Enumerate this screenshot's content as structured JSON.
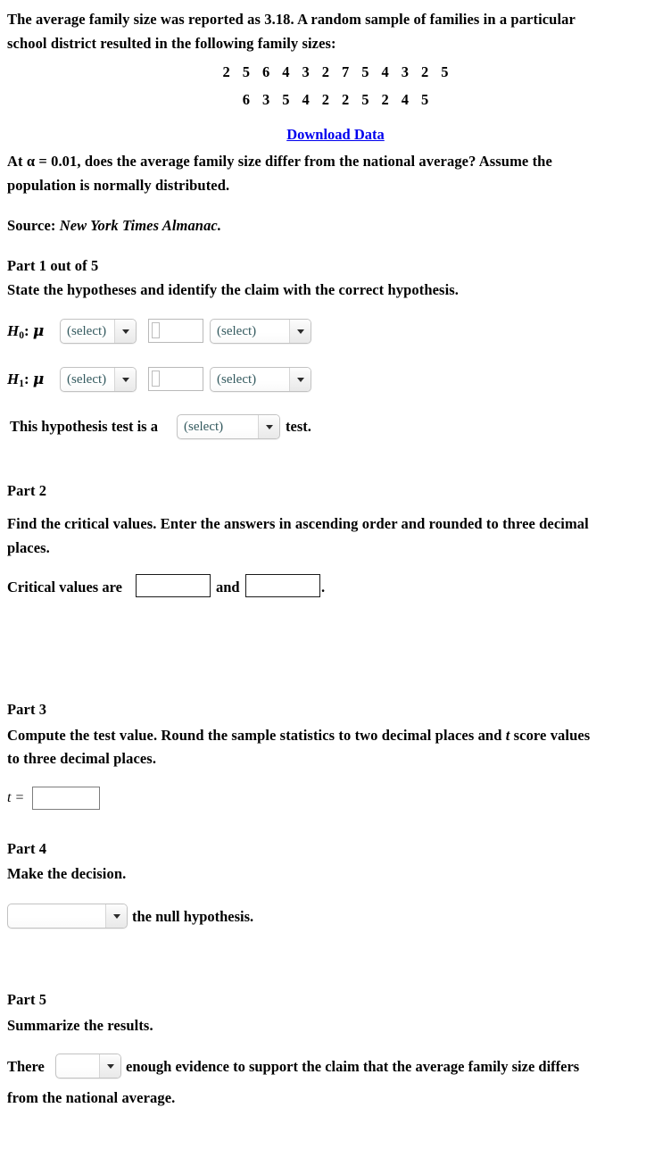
{
  "problem": {
    "intro_line1": "The average family size was reported as 3.18. A random sample of families in a particular",
    "intro_line2": "school district resulted in the following family sizes:",
    "data_row1": [
      2,
      5,
      6,
      4,
      3,
      2,
      7,
      5,
      4,
      3,
      2,
      5
    ],
    "data_row2": [
      6,
      3,
      5,
      4,
      2,
      2,
      5,
      2,
      4,
      5
    ],
    "download_link": "Download Data",
    "question_line1": "At α = 0.01, does the average family size differ from the national average? Assume the",
    "question_line2": "population is normally distributed.",
    "source_label": "Source:",
    "source_value": "New York Times Almanac."
  },
  "part1": {
    "heading": "Part 1 out of 5",
    "instruction": "State the hypotheses and identify the claim with the correct hypothesis.",
    "h0_label_H": "H",
    "h0_label_sub": "0",
    "h0_label_colon": ":",
    "h0_label_mu": "μ",
    "h1_label_H": "H",
    "h1_label_sub": "1",
    "h1_label_colon": ":",
    "h1_label_mu": "μ",
    "h0_operator_select": "(select)",
    "h0_value_input": "",
    "h0_claim_select": "(select)",
    "h1_operator_select": "(select)",
    "h1_value_input": "",
    "h1_claim_select": "(select)",
    "test_type_prefix": "This hypothesis test is a",
    "test_type_select": "(select)",
    "test_type_suffix": "test."
  },
  "part2": {
    "heading": "Part 2",
    "instruction_line1": "Find the critical values. Enter the answers in ascending order and rounded to three decimal",
    "instruction_line2": "places.",
    "prefix": "Critical values are",
    "value1": "",
    "conjunction": "and",
    "value2": "",
    "suffix": "."
  },
  "part3": {
    "heading": "Part 3",
    "instruction_line1_a": "Compute the test value. Round the sample statistics to two decimal places and",
    "instruction_line1_t": "t",
    "instruction_line1_b": "score values",
    "instruction_line2": "to three decimal places.",
    "t_label": "t  =",
    "t_value": ""
  },
  "part4": {
    "heading": "Part 4",
    "instruction": "Make the decision.",
    "decision_select": "",
    "suffix": "the null hypothesis."
  },
  "part5": {
    "heading": "Part 5",
    "instruction": "Summarize the results.",
    "prefix": "There",
    "evidence_select": "",
    "middle_line1": "enough evidence to support the claim that the average family size differs",
    "middle_line2": "from the national average."
  },
  "colors": {
    "link": "#0000ee",
    "select_text": "#33595e",
    "text": "#000000"
  }
}
